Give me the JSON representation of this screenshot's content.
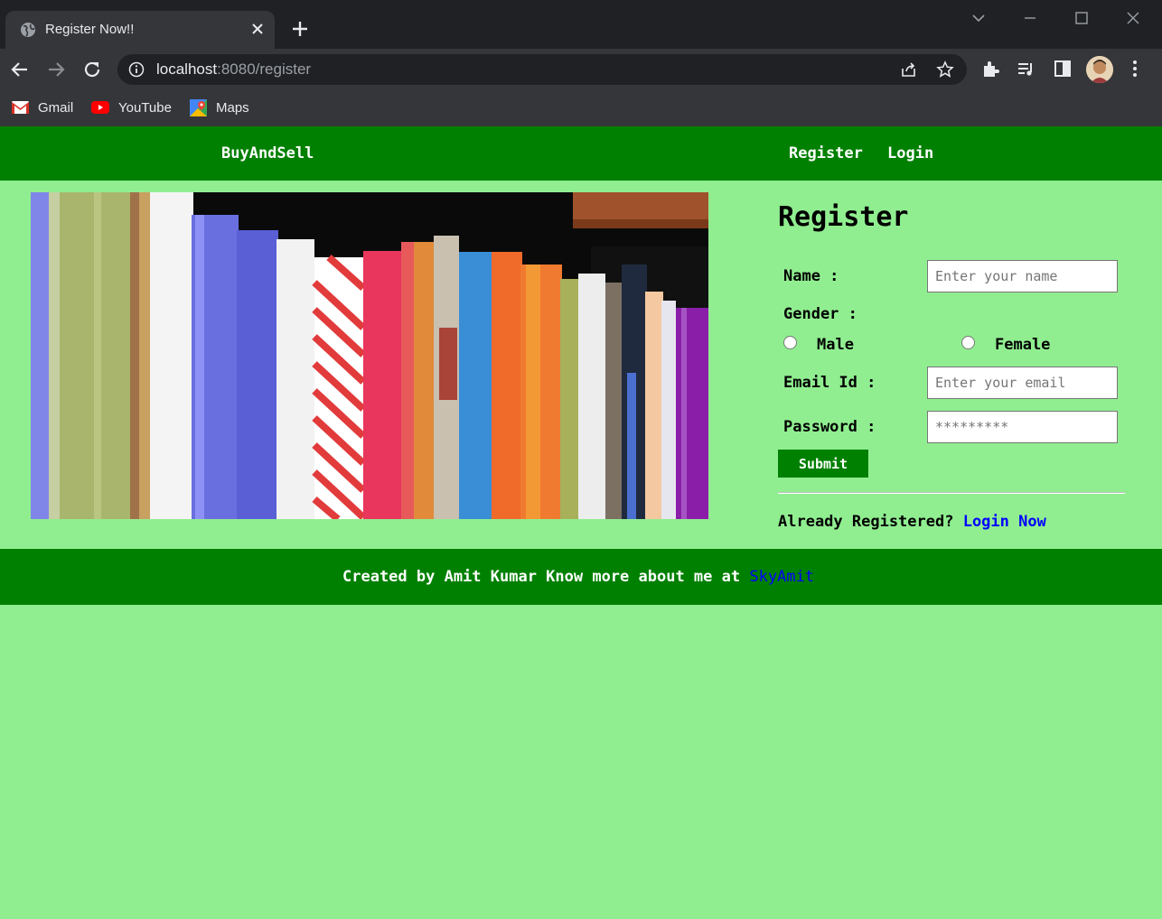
{
  "browser": {
    "tab_title": "Register Now!!",
    "url_host": "localhost",
    "url_rest": ":8080/register",
    "bookmarks": [
      "Gmail",
      "YouTube",
      "Maps"
    ]
  },
  "navbar": {
    "brand": "BuyAndSell",
    "links": [
      "Register",
      "Login"
    ]
  },
  "form": {
    "title": "Register",
    "name_label": "Name :",
    "name_placeholder": "Enter your name",
    "gender_label": "Gender :",
    "male_label": "Male",
    "female_label": "Female",
    "email_label": "Email Id :",
    "email_placeholder": "Enter your email",
    "password_label": "Password :",
    "password_placeholder": "*********",
    "submit_label": "Submit",
    "already_text": "Already Registered? ",
    "login_now": "Login Now"
  },
  "footer": {
    "text": "Created by Amit Kumar Know more about me at ",
    "link": "SkyAmit"
  },
  "colors": {
    "page_bg": "#90EE90",
    "nav_bg": "#008000",
    "link": "#0000FF"
  }
}
